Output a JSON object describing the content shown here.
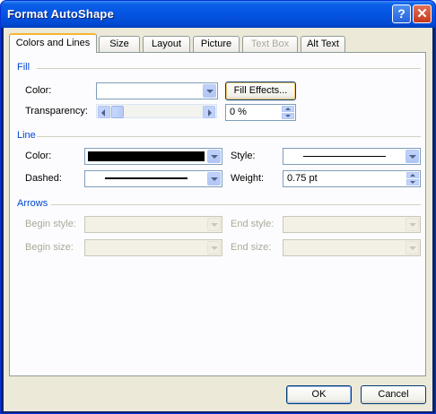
{
  "window": {
    "title": "Format AutoShape",
    "help_glyph": "?",
    "close_glyph": "✕"
  },
  "tabs": [
    {
      "label": "Colors and Lines",
      "state": "active"
    },
    {
      "label": "Size",
      "state": "normal"
    },
    {
      "label": "Layout",
      "state": "normal"
    },
    {
      "label": "Picture",
      "state": "normal"
    },
    {
      "label": "Text Box",
      "state": "disabled"
    },
    {
      "label": "Alt Text",
      "state": "normal"
    }
  ],
  "fill": {
    "section_label": "Fill",
    "color_label": "Color:",
    "color_value": "",
    "fill_effects_label": "Fill Effects...",
    "transparency_label": "Transparency:",
    "transparency_value": "0 %"
  },
  "line": {
    "section_label": "Line",
    "color_label": "Color:",
    "color_swatch": "#000000",
    "style_label": "Style:",
    "dashed_label": "Dashed:",
    "weight_label": "Weight:",
    "weight_value": "0.75 pt"
  },
  "arrows": {
    "section_label": "Arrows",
    "begin_style_label": "Begin style:",
    "end_style_label": "End style:",
    "begin_size_label": "Begin size:",
    "end_size_label": "End size:"
  },
  "buttons": {
    "ok": "OK",
    "cancel": "Cancel"
  },
  "colors": {
    "titlebar": "#0554e3",
    "section_heading": "#0046d5",
    "dialog_bg": "#ece9d8"
  }
}
